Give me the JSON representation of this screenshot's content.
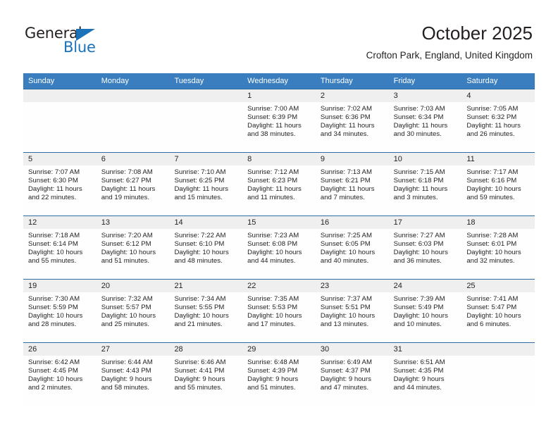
{
  "brand": {
    "name_part1": "General",
    "name_part2": "Blue",
    "accent_color": "#1b72b8"
  },
  "header": {
    "title": "October 2025",
    "location": "Crofton Park, England, United Kingdom"
  },
  "calendar": {
    "header_bg": "#3a7ebf",
    "weekdays": [
      "Sunday",
      "Monday",
      "Tuesday",
      "Wednesday",
      "Thursday",
      "Friday",
      "Saturday"
    ],
    "weeks": [
      [
        {
          "day": "",
          "empty": true
        },
        {
          "day": "",
          "empty": true
        },
        {
          "day": "",
          "empty": true
        },
        {
          "day": "1",
          "sunrise": "Sunrise: 7:00 AM",
          "sunset": "Sunset: 6:39 PM",
          "daylight1": "Daylight: 11 hours",
          "daylight2": "and 38 minutes."
        },
        {
          "day": "2",
          "sunrise": "Sunrise: 7:02 AM",
          "sunset": "Sunset: 6:36 PM",
          "daylight1": "Daylight: 11 hours",
          "daylight2": "and 34 minutes."
        },
        {
          "day": "3",
          "sunrise": "Sunrise: 7:03 AM",
          "sunset": "Sunset: 6:34 PM",
          "daylight1": "Daylight: 11 hours",
          "daylight2": "and 30 minutes."
        },
        {
          "day": "4",
          "sunrise": "Sunrise: 7:05 AM",
          "sunset": "Sunset: 6:32 PM",
          "daylight1": "Daylight: 11 hours",
          "daylight2": "and 26 minutes."
        }
      ],
      [
        {
          "day": "5",
          "sunrise": "Sunrise: 7:07 AM",
          "sunset": "Sunset: 6:30 PM",
          "daylight1": "Daylight: 11 hours",
          "daylight2": "and 22 minutes."
        },
        {
          "day": "6",
          "sunrise": "Sunrise: 7:08 AM",
          "sunset": "Sunset: 6:27 PM",
          "daylight1": "Daylight: 11 hours",
          "daylight2": "and 19 minutes."
        },
        {
          "day": "7",
          "sunrise": "Sunrise: 7:10 AM",
          "sunset": "Sunset: 6:25 PM",
          "daylight1": "Daylight: 11 hours",
          "daylight2": "and 15 minutes."
        },
        {
          "day": "8",
          "sunrise": "Sunrise: 7:12 AM",
          "sunset": "Sunset: 6:23 PM",
          "daylight1": "Daylight: 11 hours",
          "daylight2": "and 11 minutes."
        },
        {
          "day": "9",
          "sunrise": "Sunrise: 7:13 AM",
          "sunset": "Sunset: 6:21 PM",
          "daylight1": "Daylight: 11 hours",
          "daylight2": "and 7 minutes."
        },
        {
          "day": "10",
          "sunrise": "Sunrise: 7:15 AM",
          "sunset": "Sunset: 6:18 PM",
          "daylight1": "Daylight: 11 hours",
          "daylight2": "and 3 minutes."
        },
        {
          "day": "11",
          "sunrise": "Sunrise: 7:17 AM",
          "sunset": "Sunset: 6:16 PM",
          "daylight1": "Daylight: 10 hours",
          "daylight2": "and 59 minutes."
        }
      ],
      [
        {
          "day": "12",
          "sunrise": "Sunrise: 7:18 AM",
          "sunset": "Sunset: 6:14 PM",
          "daylight1": "Daylight: 10 hours",
          "daylight2": "and 55 minutes."
        },
        {
          "day": "13",
          "sunrise": "Sunrise: 7:20 AM",
          "sunset": "Sunset: 6:12 PM",
          "daylight1": "Daylight: 10 hours",
          "daylight2": "and 51 minutes."
        },
        {
          "day": "14",
          "sunrise": "Sunrise: 7:22 AM",
          "sunset": "Sunset: 6:10 PM",
          "daylight1": "Daylight: 10 hours",
          "daylight2": "and 48 minutes."
        },
        {
          "day": "15",
          "sunrise": "Sunrise: 7:23 AM",
          "sunset": "Sunset: 6:08 PM",
          "daylight1": "Daylight: 10 hours",
          "daylight2": "and 44 minutes."
        },
        {
          "day": "16",
          "sunrise": "Sunrise: 7:25 AM",
          "sunset": "Sunset: 6:05 PM",
          "daylight1": "Daylight: 10 hours",
          "daylight2": "and 40 minutes."
        },
        {
          "day": "17",
          "sunrise": "Sunrise: 7:27 AM",
          "sunset": "Sunset: 6:03 PM",
          "daylight1": "Daylight: 10 hours",
          "daylight2": "and 36 minutes."
        },
        {
          "day": "18",
          "sunrise": "Sunrise: 7:28 AM",
          "sunset": "Sunset: 6:01 PM",
          "daylight1": "Daylight: 10 hours",
          "daylight2": "and 32 minutes."
        }
      ],
      [
        {
          "day": "19",
          "sunrise": "Sunrise: 7:30 AM",
          "sunset": "Sunset: 5:59 PM",
          "daylight1": "Daylight: 10 hours",
          "daylight2": "and 28 minutes."
        },
        {
          "day": "20",
          "sunrise": "Sunrise: 7:32 AM",
          "sunset": "Sunset: 5:57 PM",
          "daylight1": "Daylight: 10 hours",
          "daylight2": "and 25 minutes."
        },
        {
          "day": "21",
          "sunrise": "Sunrise: 7:34 AM",
          "sunset": "Sunset: 5:55 PM",
          "daylight1": "Daylight: 10 hours",
          "daylight2": "and 21 minutes."
        },
        {
          "day": "22",
          "sunrise": "Sunrise: 7:35 AM",
          "sunset": "Sunset: 5:53 PM",
          "daylight1": "Daylight: 10 hours",
          "daylight2": "and 17 minutes."
        },
        {
          "day": "23",
          "sunrise": "Sunrise: 7:37 AM",
          "sunset": "Sunset: 5:51 PM",
          "daylight1": "Daylight: 10 hours",
          "daylight2": "and 13 minutes."
        },
        {
          "day": "24",
          "sunrise": "Sunrise: 7:39 AM",
          "sunset": "Sunset: 5:49 PM",
          "daylight1": "Daylight: 10 hours",
          "daylight2": "and 10 minutes."
        },
        {
          "day": "25",
          "sunrise": "Sunrise: 7:41 AM",
          "sunset": "Sunset: 5:47 PM",
          "daylight1": "Daylight: 10 hours",
          "daylight2": "and 6 minutes."
        }
      ],
      [
        {
          "day": "26",
          "sunrise": "Sunrise: 6:42 AM",
          "sunset": "Sunset: 4:45 PM",
          "daylight1": "Daylight: 10 hours",
          "daylight2": "and 2 minutes."
        },
        {
          "day": "27",
          "sunrise": "Sunrise: 6:44 AM",
          "sunset": "Sunset: 4:43 PM",
          "daylight1": "Daylight: 9 hours",
          "daylight2": "and 58 minutes."
        },
        {
          "day": "28",
          "sunrise": "Sunrise: 6:46 AM",
          "sunset": "Sunset: 4:41 PM",
          "daylight1": "Daylight: 9 hours",
          "daylight2": "and 55 minutes."
        },
        {
          "day": "29",
          "sunrise": "Sunrise: 6:48 AM",
          "sunset": "Sunset: 4:39 PM",
          "daylight1": "Daylight: 9 hours",
          "daylight2": "and 51 minutes."
        },
        {
          "day": "30",
          "sunrise": "Sunrise: 6:49 AM",
          "sunset": "Sunset: 4:37 PM",
          "daylight1": "Daylight: 9 hours",
          "daylight2": "and 47 minutes."
        },
        {
          "day": "31",
          "sunrise": "Sunrise: 6:51 AM",
          "sunset": "Sunset: 4:35 PM",
          "daylight1": "Daylight: 9 hours",
          "daylight2": "and 44 minutes."
        },
        {
          "day": "",
          "empty": true
        }
      ]
    ]
  }
}
